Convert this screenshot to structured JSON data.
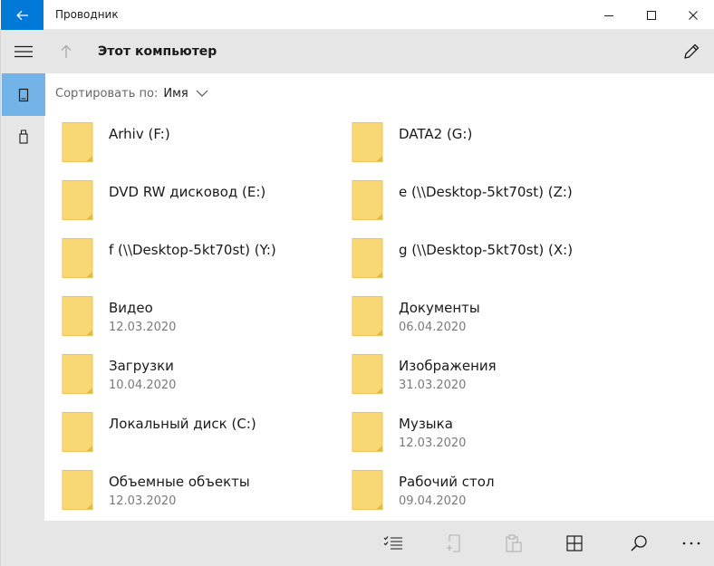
{
  "app": {
    "title": "Проводник"
  },
  "toolbar": {
    "location": "Этот компьютер"
  },
  "sort": {
    "label": "Сортировать по:",
    "value": "Имя"
  },
  "items": [
    {
      "name": "Arhiv (F:)",
      "date": ""
    },
    {
      "name": "DATA2 (G:)",
      "date": ""
    },
    {
      "name": "DVD RW дисковод (E:)",
      "date": ""
    },
    {
      "name": "e (\\\\Desktop-5kt70st) (Z:)",
      "date": ""
    },
    {
      "name": "f (\\\\Desktop-5kt70st) (Y:)",
      "date": ""
    },
    {
      "name": "g (\\\\Desktop-5kt70st) (X:)",
      "date": ""
    },
    {
      "name": "Видео",
      "date": "12.03.2020"
    },
    {
      "name": "Документы",
      "date": "06.04.2020"
    },
    {
      "name": "Загрузки",
      "date": "10.04.2020"
    },
    {
      "name": "Изображения",
      "date": "31.03.2020"
    },
    {
      "name": "Локальный диск (C:)",
      "date": ""
    },
    {
      "name": "Музыка",
      "date": "12.03.2020"
    },
    {
      "name": "Объемные объекты",
      "date": "12.03.2020"
    },
    {
      "name": "Рабочий стол",
      "date": "09.04.2020"
    }
  ],
  "colors": {
    "accent": "#0078d7",
    "selected_nav": "#73b3e8",
    "panel": "#e6e6e6",
    "folder": "#f8d775",
    "folder_dark": "#e7b84a"
  },
  "icons": {
    "back": "arrow-left-icon",
    "menu": "hamburger-icon",
    "up": "arrow-up-icon",
    "edit": "pencil-icon",
    "select": "checklist-icon",
    "new_item": "new-item-icon",
    "paste": "clipboard-icon",
    "view": "grid-view-icon",
    "search": "search-icon",
    "more": "more-icon"
  }
}
